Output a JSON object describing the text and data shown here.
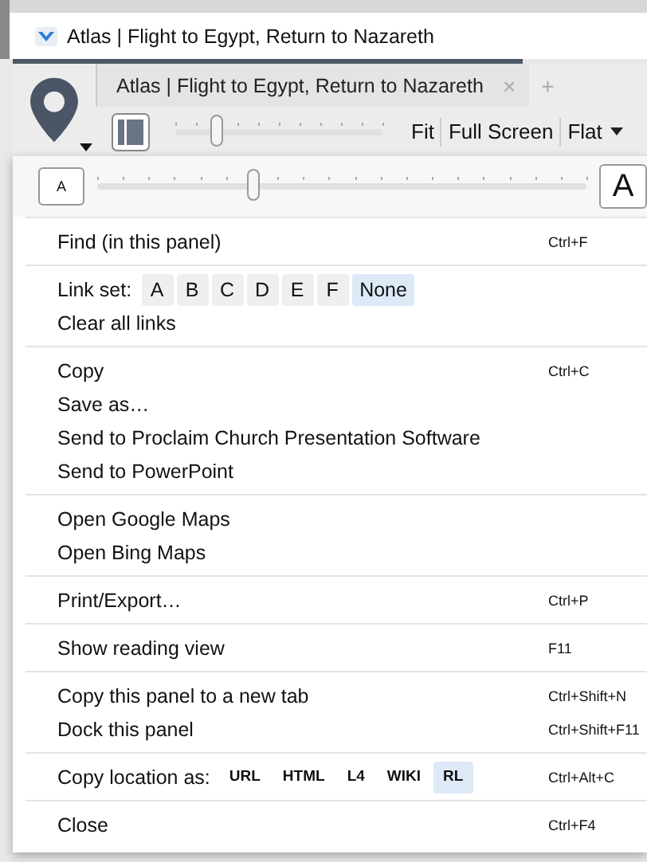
{
  "window": {
    "title": "Atlas | Flight to Egypt, Return to Nazareth"
  },
  "tab": {
    "title": "Atlas | Flight to Egypt, Return to Nazareth",
    "close": "×",
    "new_tab": "+"
  },
  "toolbar": {
    "zoom": {
      "level": 0.2
    },
    "buttons": [
      {
        "label": "Fit",
        "kind": "plain"
      },
      {
        "label": "Full Screen",
        "kind": "plain"
      },
      {
        "label": "Flat",
        "kind": "dropdown"
      }
    ]
  },
  "font_size": {
    "small": "A",
    "large": "A",
    "level": 0.32
  },
  "menu": [
    {
      "items": [
        {
          "kind": "item",
          "label": "Find (in this panel)",
          "shortcut": "Ctrl+F"
        }
      ]
    },
    {
      "items": [
        {
          "kind": "choices",
          "label": "Link set:",
          "options": [
            {
              "label": "A",
              "selected": false
            },
            {
              "label": "B",
              "selected": false
            },
            {
              "label": "C",
              "selected": false
            },
            {
              "label": "D",
              "selected": false
            },
            {
              "label": "E",
              "selected": false
            },
            {
              "label": "F",
              "selected": false
            },
            {
              "label": "None",
              "selected": true
            }
          ]
        },
        {
          "kind": "item",
          "label": "Clear all links"
        }
      ]
    },
    {
      "items": [
        {
          "kind": "item",
          "label": "Copy",
          "shortcut": "Ctrl+C"
        },
        {
          "kind": "item",
          "label": "Save as…"
        },
        {
          "kind": "item",
          "label": "Send to Proclaim Church Presentation Software"
        },
        {
          "kind": "item",
          "label": "Send to PowerPoint"
        }
      ]
    },
    {
      "items": [
        {
          "kind": "item",
          "label": "Open Google Maps"
        },
        {
          "kind": "item",
          "label": "Open Bing Maps"
        }
      ]
    },
    {
      "items": [
        {
          "kind": "item",
          "label": "Print/Export…",
          "shortcut": "Ctrl+P"
        }
      ]
    },
    {
      "items": [
        {
          "kind": "item",
          "label": "Show reading view",
          "shortcut": "F11"
        }
      ]
    },
    {
      "items": [
        {
          "kind": "item",
          "label": "Copy this panel to a new tab",
          "shortcut": "Ctrl+Shift+N"
        },
        {
          "kind": "item",
          "label": "Dock this panel",
          "shortcut": "Ctrl+Shift+F11"
        }
      ]
    },
    {
      "items": [
        {
          "kind": "format-choices",
          "label": "Copy location as:",
          "shortcut": "Ctrl+Alt+C",
          "options": [
            {
              "label": "URL",
              "selected": false
            },
            {
              "label": "HTML",
              "selected": false
            },
            {
              "label": "L4",
              "selected": false
            },
            {
              "label": "WIKI",
              "selected": false
            },
            {
              "label": "RL",
              "selected": true
            }
          ]
        }
      ]
    },
    {
      "items": [
        {
          "kind": "item",
          "label": "Close",
          "shortcut": "Ctrl+F4"
        }
      ]
    }
  ]
}
